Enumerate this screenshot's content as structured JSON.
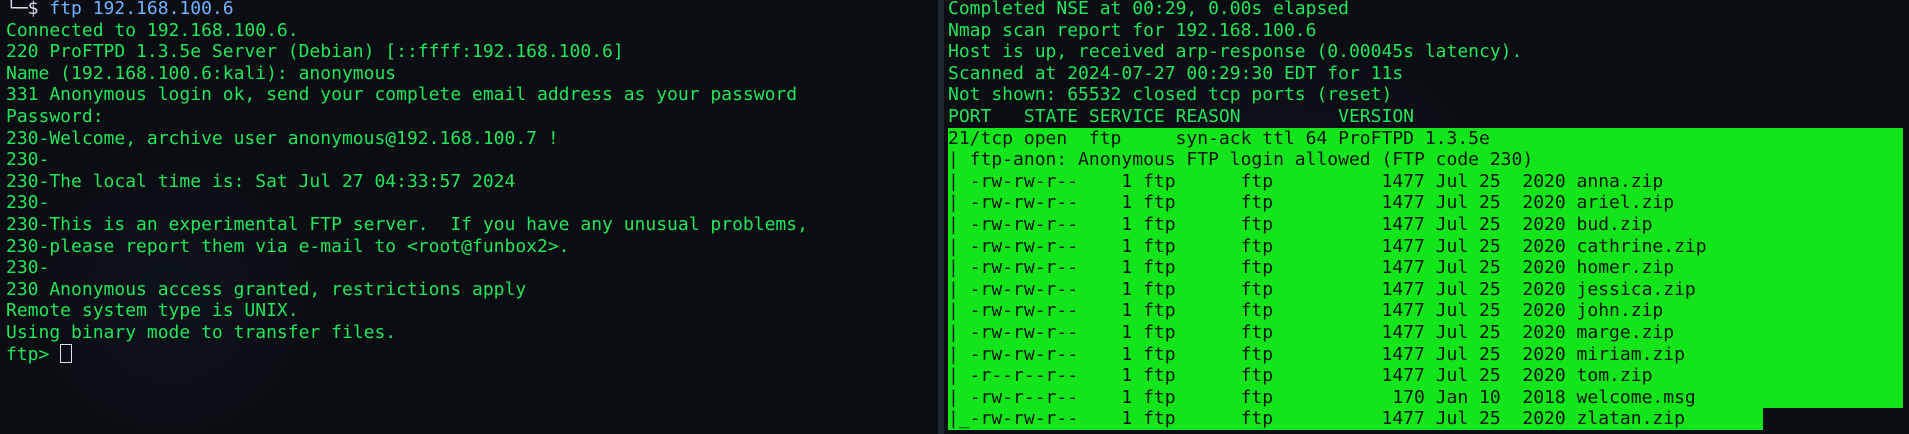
{
  "left_terminal": {
    "prompt_prefix": "└─$ ",
    "command": "ftp 192.168.100.6",
    "lines": [
      "Connected to 192.168.100.6.",
      "220 ProFTPD 1.3.5e Server (Debian) [::ffff:192.168.100.6]",
      "Name (192.168.100.6:kali): anonymous",
      "331 Anonymous login ok, send your complete email address as your password",
      "Password:",
      "230-Welcome, archive user anonymous@192.168.100.7 !",
      "230-",
      "230-The local time is: Sat Jul 27 04:33:57 2024",
      "230-",
      "230-This is an experimental FTP server.  If you have any unusual problems,",
      "230-please report them via e-mail to <root@funbox2>.",
      "230-",
      "230 Anonymous access granted, restrictions apply",
      "Remote system type is UNIX.",
      "Using binary mode to transfer files."
    ],
    "ftp_prompt": "ftp> "
  },
  "right_terminal": {
    "lines": [
      "Completed NSE at 00:29, 0.00s elapsed",
      "Nmap scan report for 192.168.100.6",
      "Host is up, received arp-response (0.00045s latency).",
      "Scanned at 2024-07-27 00:29:30 EDT for 11s",
      "Not shown: 65532 closed tcp ports (reset)"
    ],
    "header": "PORT   STATE SERVICE REASON         VERSION",
    "port_line": "21/tcp open  ftp     syn-ack ttl 64 ProFTPD 1.3.5e",
    "ftp_anon_line": "| ftp-anon: Anonymous FTP login allowed (FTP code 230)",
    "files": [
      "| -rw-rw-r--    1 ftp      ftp          1477 Jul 25  2020 anna.zip",
      "| -rw-rw-r--    1 ftp      ftp          1477 Jul 25  2020 ariel.zip",
      "| -rw-rw-r--    1 ftp      ftp          1477 Jul 25  2020 bud.zip",
      "| -rw-rw-r--    1 ftp      ftp          1477 Jul 25  2020 cathrine.zip",
      "| -rw-rw-r--    1 ftp      ftp          1477 Jul 25  2020 homer.zip",
      "| -rw-rw-r--    1 ftp      ftp          1477 Jul 25  2020 jessica.zip",
      "| -rw-rw-r--    1 ftp      ftp          1477 Jul 25  2020 john.zip",
      "| -rw-rw-r--    1 ftp      ftp          1477 Jul 25  2020 marge.zip",
      "| -rw-rw-r--    1 ftp      ftp          1477 Jul 25  2020 miriam.zip",
      "| -r--r--r--    1 ftp      ftp          1477 Jul 25  2020 tom.zip",
      "| -rw-r--r--    1 ftp      ftp           170 Jan 10  2018 welcome.msg",
      "|_-rw-rw-r--    1 ftp      ftp          1477 Jul 25  2020 zlatan.zip"
    ]
  },
  "colors": {
    "terminal_bg": "#0a0d12",
    "text_green": "#22e55a",
    "highlight_green": "#12e61a",
    "command_blue": "#6fb4ff"
  }
}
